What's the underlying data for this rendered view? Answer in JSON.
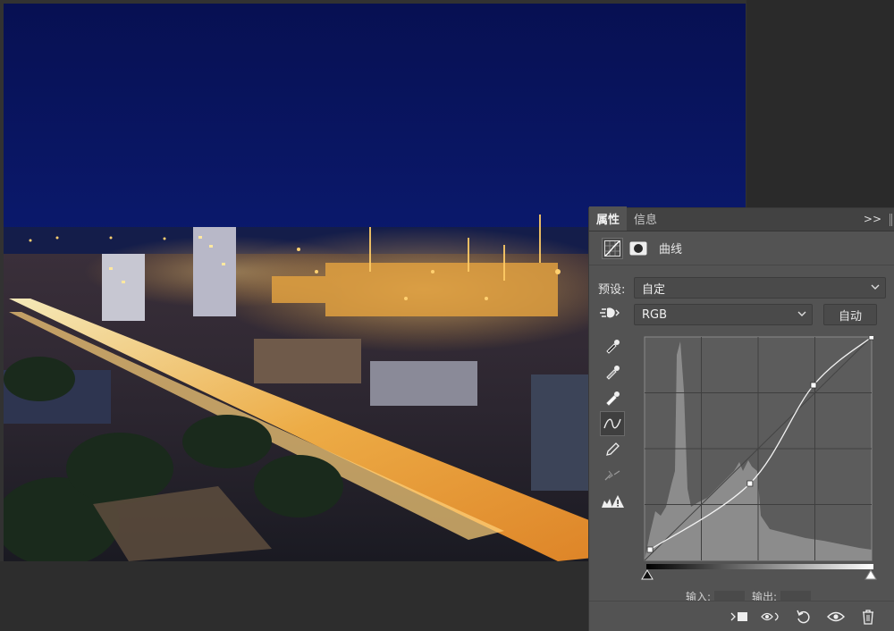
{
  "panel": {
    "tabs": [
      {
        "label": "属性",
        "active": true
      },
      {
        "label": "信息",
        "active": false
      }
    ],
    "menu_glyph": ">>",
    "adjustment_title": "曲线",
    "preset": {
      "label": "预设:",
      "value": "自定"
    },
    "channel": {
      "value": "RGB"
    },
    "auto_label": "自动",
    "io": {
      "input_label": "输入:",
      "output_label": "输出:"
    }
  },
  "curve": {
    "points": [
      [
        6,
        12
      ],
      [
        116,
        86
      ],
      [
        186,
        196
      ],
      [
        250,
        250
      ]
    ],
    "grid_divisions": 4
  },
  "icons": {
    "curves_adjustment": "curves-adjustment-icon",
    "mask": "mask-icon",
    "hand": "hand-tool-icon",
    "black_eyedropper": "eyedropper-black-icon",
    "gray_eyedropper": "eyedropper-gray-icon",
    "white_eyedropper": "eyedropper-white-icon",
    "curve_tool": "curve-edit-icon",
    "pencil": "pencil-icon",
    "smooth": "smooth-curve-icon",
    "clipping_warning": "clipping-warning-icon",
    "clip_to_layer": "clip-to-layer-icon",
    "view_previous": "view-previous-state-icon",
    "reset": "reset-icon",
    "visibility": "eye-icon",
    "delete": "trash-icon"
  },
  "colors": {
    "panel_bg": "#535353",
    "sky": "#0b1a66",
    "city_lights": "#f4a431"
  }
}
